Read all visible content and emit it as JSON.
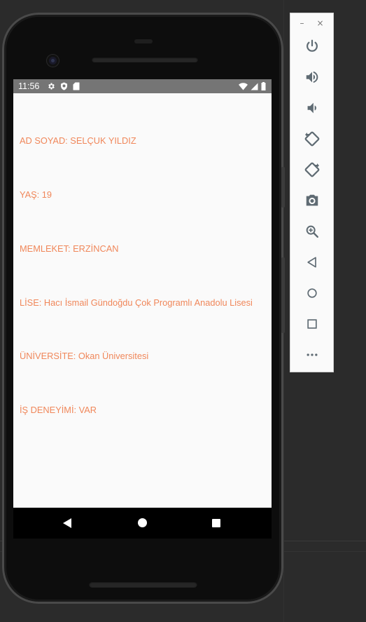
{
  "status_bar": {
    "time": "11:56",
    "left_icons": [
      "gear-icon",
      "shield-icon",
      "sd-card-icon"
    ],
    "right_icons": [
      "wifi-icon",
      "cellular-signal-icon",
      "battery-icon"
    ]
  },
  "profile": {
    "rows": [
      "AD SOYAD: SELÇUK YILDIZ",
      "YAŞ: 19",
      "MEMLEKET: ERZİNCAN",
      "LİSE: Hacı İsmail Gündoğdu Çok Programlı Anadolu Lisesi",
      "ÜNİVERSİTE: Okan Üniversitesi",
      "İŞ DENEYİMİ: VAR"
    ]
  },
  "nav_bar": {
    "buttons": [
      "back-icon",
      "home-icon",
      "recents-icon"
    ]
  },
  "emulator_toolbar": {
    "minimize_label": "–",
    "close_label": "×",
    "tools": [
      "power-icon",
      "volume-up-icon",
      "volume-down-icon",
      "rotate-left-icon",
      "rotate-right-icon",
      "camera-icon",
      "zoom-icon",
      "back-icon",
      "home-icon",
      "overview-icon",
      "more-icon"
    ]
  },
  "colors": {
    "text_accent": "#f0875a",
    "status_bar": "#757575",
    "screen_bg": "#fafafa",
    "toolbar_icon": "#5f6b73"
  }
}
